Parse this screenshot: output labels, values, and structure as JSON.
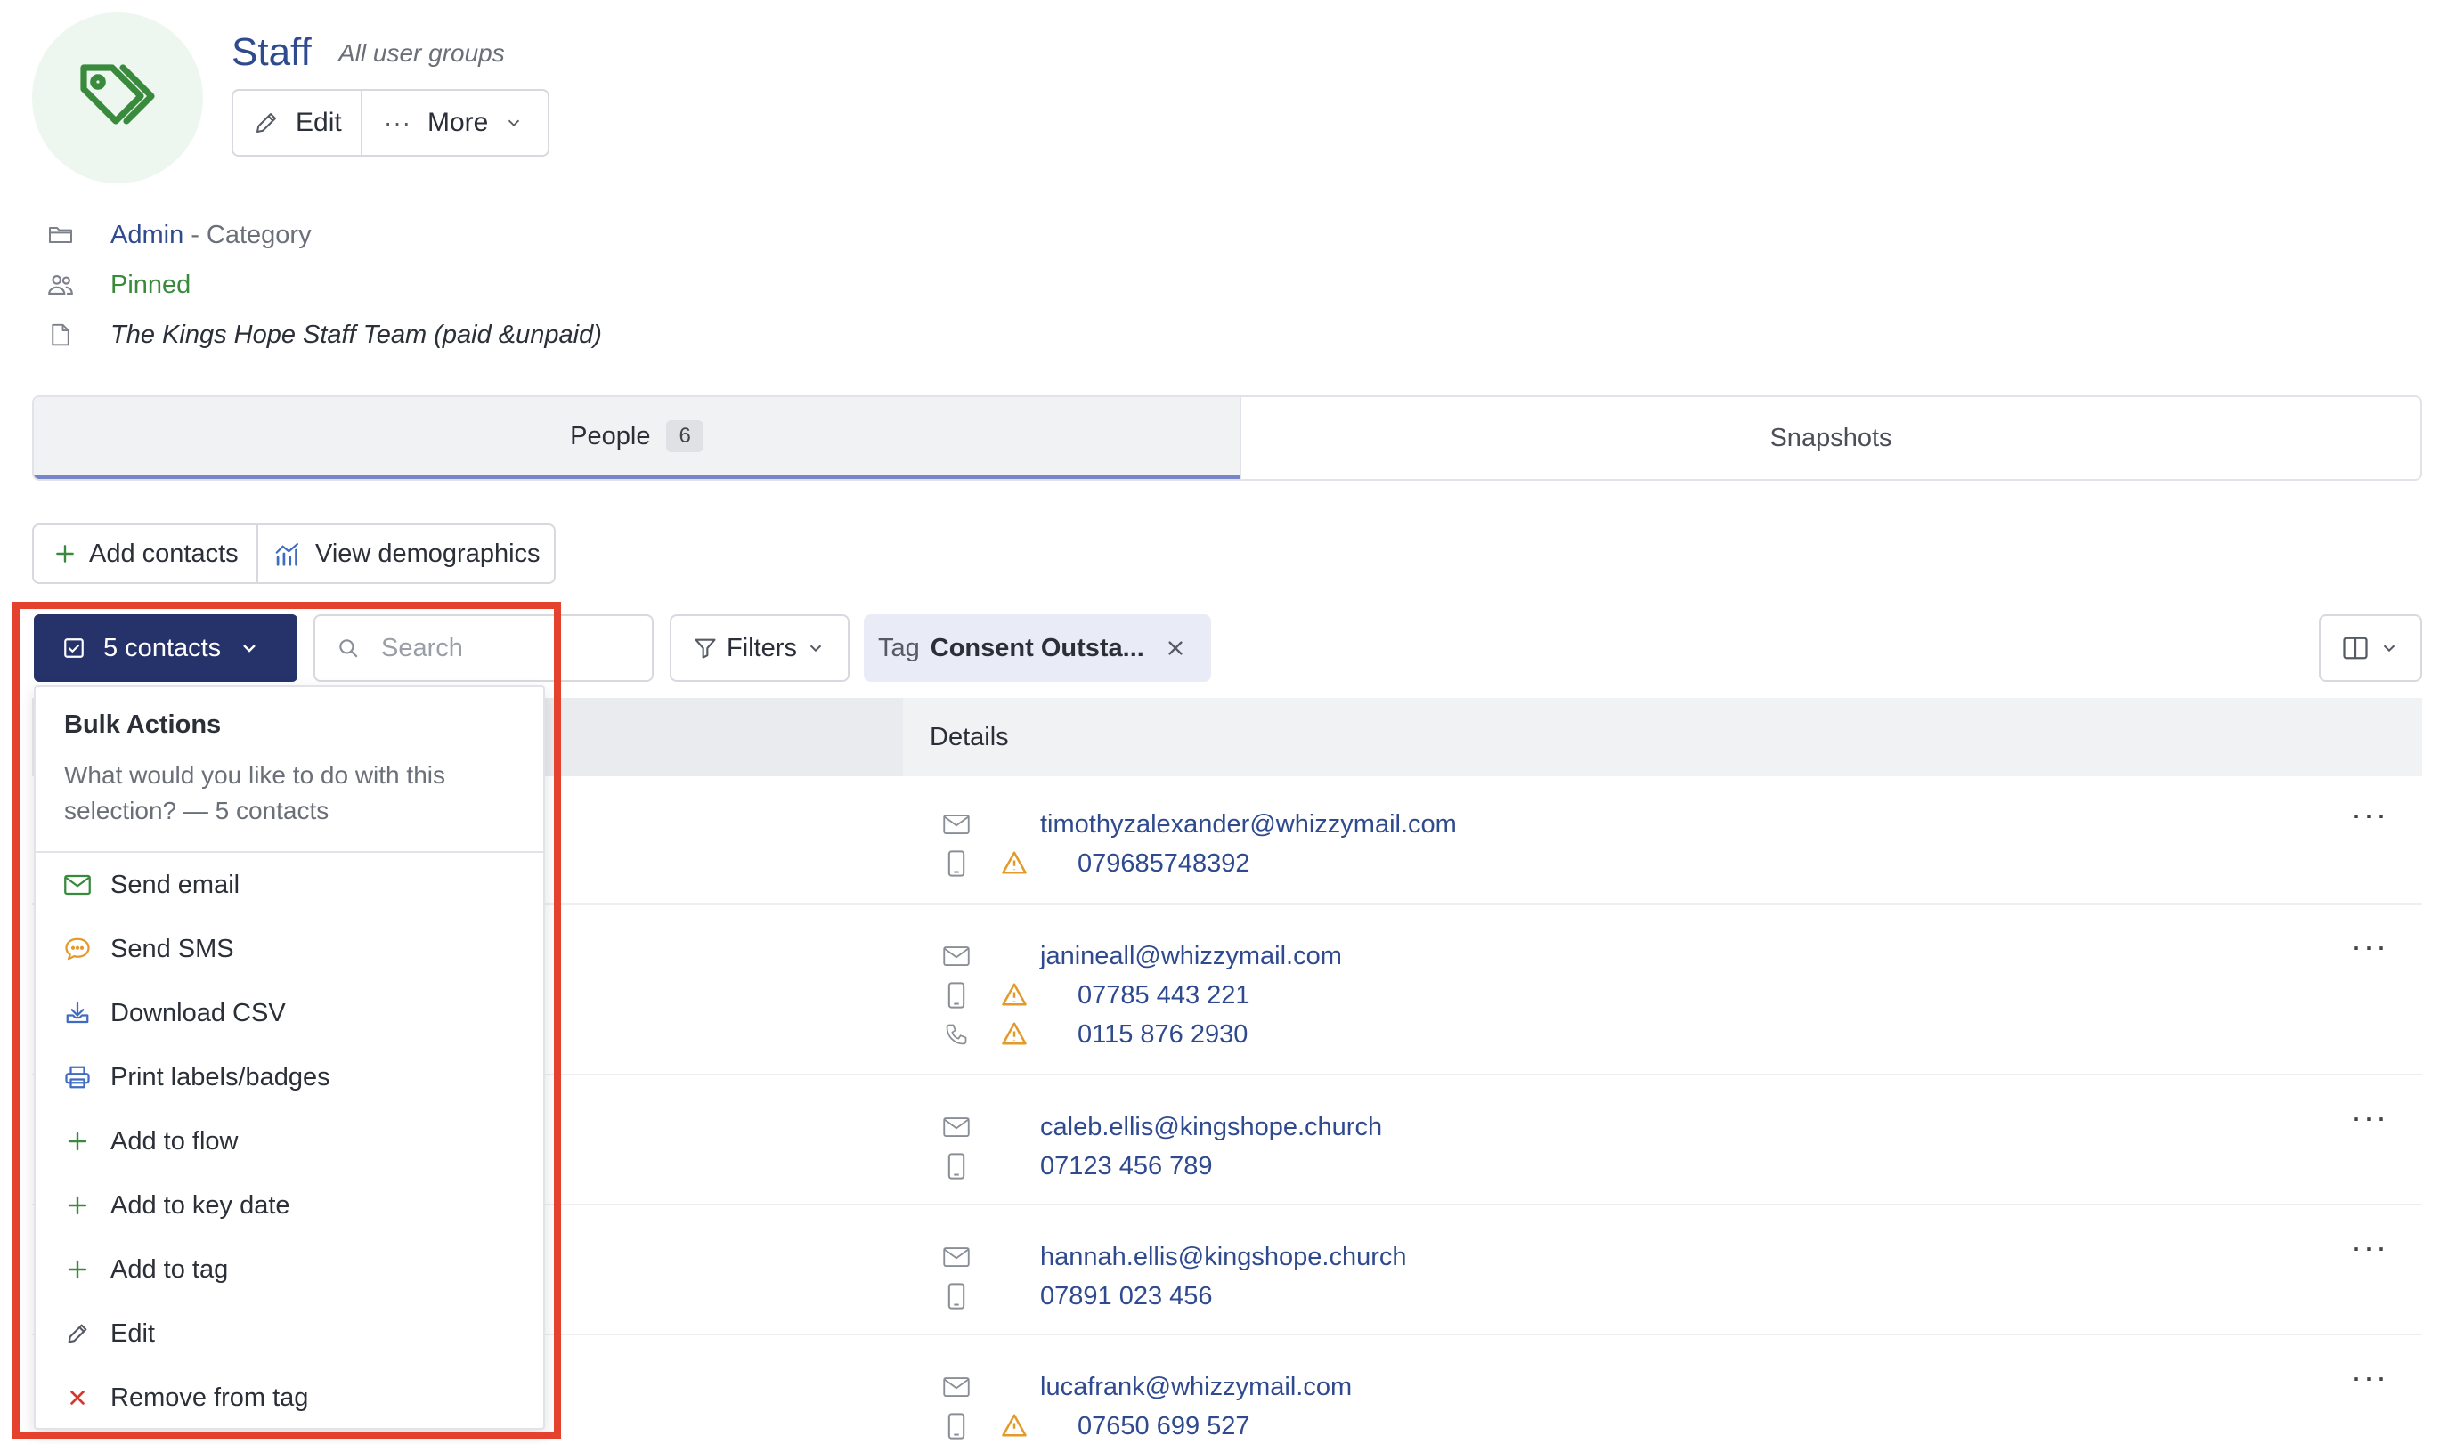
{
  "header": {
    "title": "Staff",
    "subtitle": "All user groups",
    "edit_label": "Edit",
    "more_label": "More",
    "icon": "tag-icon",
    "icon_color": "#3a8a3e"
  },
  "meta": {
    "category_link": "Admin",
    "category_suffix": "- Category",
    "pinned": "Pinned",
    "description": "The Kings Hope Staff Team (paid &unpaid)"
  },
  "tabs": [
    {
      "label": "People",
      "count": "6",
      "active": true
    },
    {
      "label": "Snapshots",
      "active": false
    }
  ],
  "actions": {
    "add_contacts": "Add contacts",
    "view_demographics": "View demographics"
  },
  "toolbar": {
    "selection_label": "5 contacts",
    "search_placeholder": "Search",
    "filters_label": "Filters",
    "tag_filter_key": "Tag",
    "tag_filter_value": "Consent Outsta..."
  },
  "table": {
    "details_header": "Details",
    "rows": [
      {
        "email": "timothyzalexander@whizzymail.com",
        "mobile": "079685748392",
        "mobile_warning": true
      },
      {
        "email": "janineall@whizzymail.com",
        "mobile": "07785 443 221",
        "mobile_warning": true,
        "phone": "0115 876 2930",
        "phone_warning": true
      },
      {
        "email": "caleb.ellis@kingshope.church",
        "mobile": "07123 456 789",
        "mobile_warning": false
      },
      {
        "email": "hannah.ellis@kingshope.church",
        "mobile": "07891 023 456",
        "mobile_warning": false
      },
      {
        "email": "lucafrank@whizzymail.com",
        "mobile": "07650 699 527",
        "mobile_warning": true
      }
    ]
  },
  "bulk_actions": {
    "title": "Bulk Actions",
    "description": "What would you like to do with this selection? — 5 contacts",
    "items": [
      {
        "label": "Send email",
        "icon": "mail-icon",
        "color": "#3a8a3e"
      },
      {
        "label": "Send SMS",
        "icon": "chat-icon",
        "color": "#e39a2a"
      },
      {
        "label": "Download CSV",
        "icon": "download-icon",
        "color": "#3f6cc0"
      },
      {
        "label": "Print labels/badges",
        "icon": "printer-icon",
        "color": "#3f6cc0"
      },
      {
        "label": "Add to flow",
        "icon": "plus-icon",
        "color": "#3a8a3e"
      },
      {
        "label": "Add to key date",
        "icon": "plus-icon",
        "color": "#3a8a3e"
      },
      {
        "label": "Add to tag",
        "icon": "plus-icon",
        "color": "#3a8a3e"
      },
      {
        "label": "Edit",
        "icon": "pencil-icon",
        "color": "#555a64"
      },
      {
        "label": "Remove from tag",
        "icon": "close-icon",
        "color": "#d9362b"
      }
    ]
  },
  "colors": {
    "primary_navy": "#26336b",
    "link_blue": "#2f4a8f",
    "highlight_red": "#e4412f",
    "warning_amber": "#e39a2a"
  }
}
